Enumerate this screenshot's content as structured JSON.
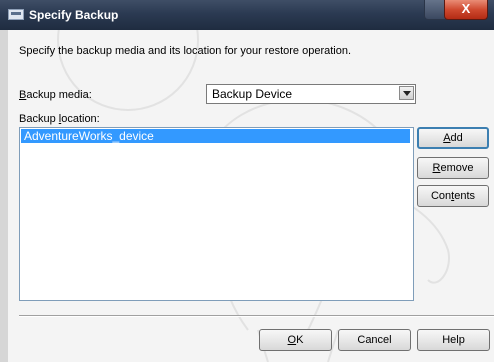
{
  "window": {
    "title": "Specify Backup",
    "close_glyph": "X"
  },
  "description": "Specify the backup media and its location for your restore operation.",
  "backup_media": {
    "label_prefix": "",
    "label_mnemonic": "B",
    "label_rest": "ackup media:",
    "selected": "Backup Device"
  },
  "backup_location": {
    "label_prefix": "Backup ",
    "label_mnemonic": "l",
    "label_rest": "ocation:",
    "items": [
      "AdventureWorks_device"
    ]
  },
  "side_buttons": {
    "add": {
      "pre": "",
      "mn": "A",
      "post": "dd"
    },
    "remove": {
      "pre": "",
      "mn": "R",
      "post": "emove"
    },
    "contents": {
      "pre": "Con",
      "mn": "t",
      "post": "ents"
    }
  },
  "bottom_buttons": {
    "ok": {
      "pre": "",
      "mn": "O",
      "post": "K"
    },
    "cancel": {
      "label": "Cancel"
    },
    "help": {
      "label": "Help"
    }
  },
  "icons": {
    "app": "window-app-icon",
    "dropdown": "chevron-down-icon"
  }
}
